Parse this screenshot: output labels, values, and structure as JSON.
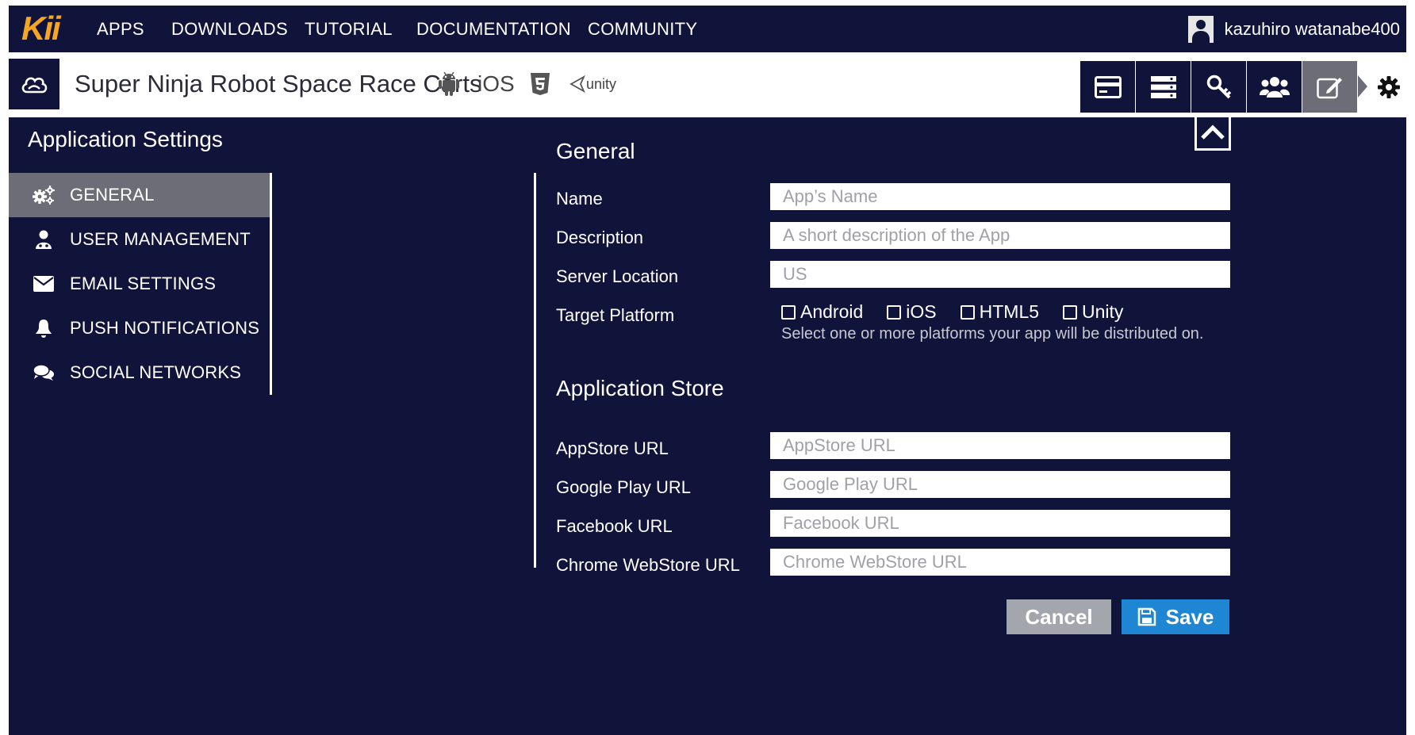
{
  "topnav": {
    "logo": "Kii",
    "items": [
      "APPS",
      "DOWNLOADS",
      "TUTORIAL",
      "DOCUMENTATION",
      "COMMUNITY"
    ],
    "user": "kazuhiro watanabe400"
  },
  "appbar": {
    "title": "Super Ninja Robot Space Race Carts",
    "platforms": [
      "android-icon",
      "iOS",
      "html5-icon",
      "unity"
    ],
    "ios_label": "iOS",
    "unity_label": "unity",
    "toolbar_icons": [
      "card-icon",
      "storage-icon",
      "key-icon",
      "users-icon",
      "edit-icon",
      "gear-icon"
    ]
  },
  "sidebar": {
    "title": "Application Settings",
    "items": [
      {
        "label": "GENERAL",
        "icon": "gears-icon",
        "active": true
      },
      {
        "label": "USER MANAGEMENT",
        "icon": "user-icon"
      },
      {
        "label": "EMAIL SETTINGS",
        "icon": "envelope-icon"
      },
      {
        "label": "PUSH NOTIFICATIONS",
        "icon": "bell-icon"
      },
      {
        "label": "SOCIAL NETWORKS",
        "icon": "chat-icon"
      }
    ]
  },
  "general": {
    "title": "General",
    "name_label": "Name",
    "name_placeholder": "App’s Name",
    "description_label": "Description",
    "description_placeholder": "A short description of the App",
    "server_label": "Server Location",
    "server_value": "US",
    "platform_label": "Target Platform",
    "platform_options": [
      "Android",
      "iOS",
      "HTML5",
      "Unity"
    ],
    "platform_help": "Select one or more platforms your app will be distributed on."
  },
  "store": {
    "title": "Application Store",
    "appstore_label": "AppStore URL",
    "appstore_placeholder": "AppStore URL",
    "googleplay_label": "Google Play URL",
    "googleplay_placeholder": "Google Play URL",
    "facebook_label": "Facebook URL",
    "facebook_placeholder": "Facebook URL",
    "chrome_label": "Chrome WebStore URL",
    "chrome_placeholder": "Chrome WebStore URL"
  },
  "actions": {
    "cancel": "Cancel",
    "save": "Save"
  },
  "colors": {
    "navy": "#10133a",
    "logo": "#f5a623",
    "active_gray": "#6d6d78",
    "save_blue": "#1f86d4",
    "cancel_gray": "#a3a6ad"
  }
}
